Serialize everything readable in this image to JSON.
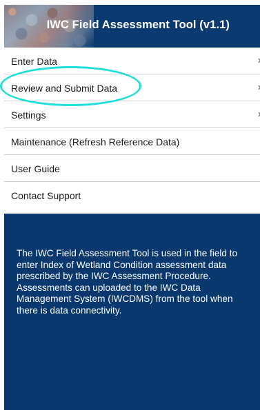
{
  "header": {
    "title": "IWC Field Assessment Tool (v1.1)",
    "image": "wetland-aerial-photo"
  },
  "menu": {
    "items": [
      {
        "label": "Enter Data",
        "icon": "chevron-right-icon"
      },
      {
        "label": "Review and Submit Data",
        "icon": "chevron-right-icon"
      },
      {
        "label": "Settings",
        "icon": "chevron-right-icon"
      },
      {
        "label": "Maintenance (Refresh Reference Data)"
      },
      {
        "label": "User Guide"
      },
      {
        "label": "Contact Support"
      }
    ],
    "chevron_glyph": "›"
  },
  "info": {
    "text": "The IWC Field Assessment Tool is used in the field to enter Index of Wetland Condition assessment data prescribed by the IWC Assessment Procedure. Assessments can uploaded to the IWC Data Management System (IWCDMS) from the tool when there is data connectivity."
  },
  "colors": {
    "header_bg": "#0b3a70",
    "panel_bg": "#08386e",
    "highlight": "#22ded9"
  }
}
